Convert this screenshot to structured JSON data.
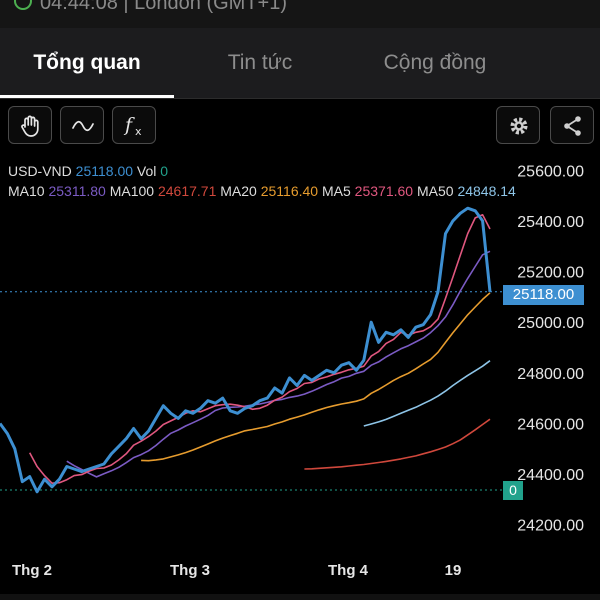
{
  "status_bar": {
    "time": "04:44:08 | London (GMT+1)"
  },
  "tabs": [
    {
      "label": "Tổng quan",
      "active": true
    },
    {
      "label": "Tin tức",
      "active": false
    },
    {
      "label": "Cộng đồng",
      "active": false
    }
  ],
  "toolbar": {
    "left_tools": [
      "hand-icon",
      "wave-icon",
      "function-icon"
    ],
    "right_tools": [
      "gear-icon",
      "share-icon"
    ]
  },
  "legend": {
    "symbol": "USD-VND",
    "price": "25118.00",
    "vol_label": "Vol",
    "vol_value": "0",
    "ma10_label": "MA10",
    "ma10_value": "25311.80",
    "ma100_label": "MA100",
    "ma100_value": "24617.71",
    "ma20_label": "MA20",
    "ma20_value": "25116.40",
    "ma5_label": "MA5",
    "ma5_value": "25371.60",
    "ma50_label": "MA50",
    "ma50_value": "24848.14"
  },
  "colors": {
    "price": "#3d8fd1",
    "ma5": "#e0577f",
    "ma10": "#7b5bc4",
    "ma20": "#e69c2e",
    "ma50": "#8ec5e8",
    "ma100": "#d0483c",
    "vol": "#21a28c"
  },
  "chart_data": {
    "type": "line",
    "ylim": [
      24120,
      25680
    ],
    "y_ticks": [
      "25600.00",
      "25400.00",
      "25200.00",
      "25000.00",
      "24800.00",
      "24600.00",
      "24400.00",
      "24200.00"
    ],
    "x_ticks": [
      "Thg 2",
      "Thg 3",
      "Thg 4",
      "19"
    ],
    "current_price_label": "25118.00",
    "current_vol_label": "0",
    "series": [
      {
        "name": "USD-VND",
        "key": "price",
        "values": [
          24600,
          24560,
          24500,
          24370,
          24390,
          24330,
          24380,
          24350,
          24380,
          24430,
          24420,
          24410,
          24420,
          24430,
          24440,
          24480,
          24510,
          24540,
          24580,
          24540,
          24570,
          24620,
          24670,
          24640,
          24620,
          24650,
          24640,
          24660,
          24690,
          24680,
          24700,
          24650,
          24640,
          24660,
          24670,
          24690,
          24700,
          24740,
          24720,
          24780,
          24750,
          24790,
          24770,
          24790,
          24810,
          24800,
          24830,
          24840,
          24810,
          24850,
          25000,
          24920,
          24960,
          24950,
          24970,
          24940,
          24980,
          24990,
          25030,
          25120,
          25350,
          25400,
          25430,
          25450,
          25440,
          25400,
          25120
        ]
      },
      {
        "name": "MA5",
        "key": "ma5",
        "values": [
          null,
          null,
          null,
          null,
          24484,
          24430,
          24394,
          24364,
          24366,
          24378,
          24394,
          24398,
          24412,
          24422,
          24424,
          24436,
          24456,
          24480,
          24514,
          24530,
          24548,
          24570,
          24596,
          24610,
          24624,
          24640,
          24650,
          24646,
          24658,
          24670,
          24674,
          24676,
          24672,
          24666,
          24656,
          24660,
          24672,
          24692,
          24704,
          24726,
          24738,
          24758,
          24762,
          24776,
          24784,
          24794,
          24802,
          24812,
          24818,
          24826,
          24866,
          24884,
          24916,
          24932,
          24960,
          24948,
          24960,
          24966,
          24982,
          25012,
          25094,
          25178,
          25264,
          25350,
          25412,
          25424,
          25368
        ]
      },
      {
        "name": "MA10",
        "key": "ma10",
        "values": [
          null,
          null,
          null,
          null,
          null,
          null,
          null,
          null,
          null,
          24451,
          24433,
          24418,
          24403,
          24389,
          24401,
          24413,
          24427,
          24445,
          24465,
          24477,
          24492,
          24513,
          24538,
          24561,
          24574,
          24590,
          24603,
          24617,
          24632,
          24651,
          24661,
          24664,
          24665,
          24668,
          24673,
          24677,
          24683,
          24691,
          24695,
          24703,
          24708,
          24716,
          24727,
          24740,
          24754,
          24765,
          24779,
          24786,
          24798,
          24806,
          24830,
          24843,
          24863,
          24879,
          24895,
          24907,
          24922,
          24937,
          24959,
          24986,
          25021,
          25069,
          25123,
          25173,
          25220,
          25266,
          25280
        ]
      },
      {
        "name": "MA20",
        "key": "ma20",
        "values": [
          null,
          null,
          null,
          null,
          null,
          null,
          null,
          null,
          null,
          null,
          null,
          null,
          null,
          null,
          null,
          null,
          null,
          null,
          null,
          24454,
          24453,
          24456,
          24460,
          24468,
          24476,
          24485,
          24495,
          24507,
          24519,
          24531,
          24542,
          24552,
          24561,
          24571,
          24576,
          24582,
          24588,
          24598,
          24606,
          24617,
          24625,
          24634,
          24644,
          24654,
          24663,
          24670,
          24677,
          24682,
          24688,
          24697,
          24719,
          24734,
          24752,
          24770,
          24785,
          24798,
          24816,
          24835,
          24853,
          24881,
          24920,
          24958,
          24994,
          25029,
          25060,
          25090,
          25116
        ]
      },
      {
        "name": "MA50",
        "key": "ma50",
        "values": [
          null,
          null,
          null,
          null,
          null,
          null,
          null,
          null,
          null,
          null,
          null,
          null,
          null,
          null,
          null,
          null,
          null,
          null,
          null,
          null,
          null,
          null,
          null,
          null,
          null,
          null,
          null,
          null,
          null,
          null,
          null,
          null,
          null,
          null,
          null,
          null,
          null,
          null,
          null,
          null,
          null,
          null,
          null,
          null,
          null,
          null,
          null,
          null,
          null,
          24590,
          24598,
          24606,
          24616,
          24628,
          24640,
          24652,
          24664,
          24678,
          24692,
          24708,
          24728,
          24750,
          24770,
          24790,
          24808,
          24826,
          24848
        ]
      },
      {
        "name": "MA100",
        "key": "ma100",
        "values": [
          null,
          null,
          null,
          null,
          null,
          null,
          null,
          null,
          null,
          null,
          null,
          null,
          null,
          null,
          null,
          null,
          null,
          null,
          null,
          null,
          null,
          null,
          null,
          null,
          null,
          null,
          null,
          null,
          null,
          null,
          null,
          null,
          null,
          null,
          null,
          null,
          null,
          null,
          null,
          null,
          null,
          24420,
          24421,
          24423,
          24425,
          24427,
          24429,
          24432,
          24435,
          24438,
          24442,
          24446,
          24450,
          24455,
          24460,
          24466,
          24472,
          24480,
          24488,
          24497,
          24507,
          24520,
          24535,
          24555,
          24575,
          24596,
          24617
        ]
      },
      {
        "name": "Vol",
        "key": "vol",
        "values": []
      }
    ]
  }
}
